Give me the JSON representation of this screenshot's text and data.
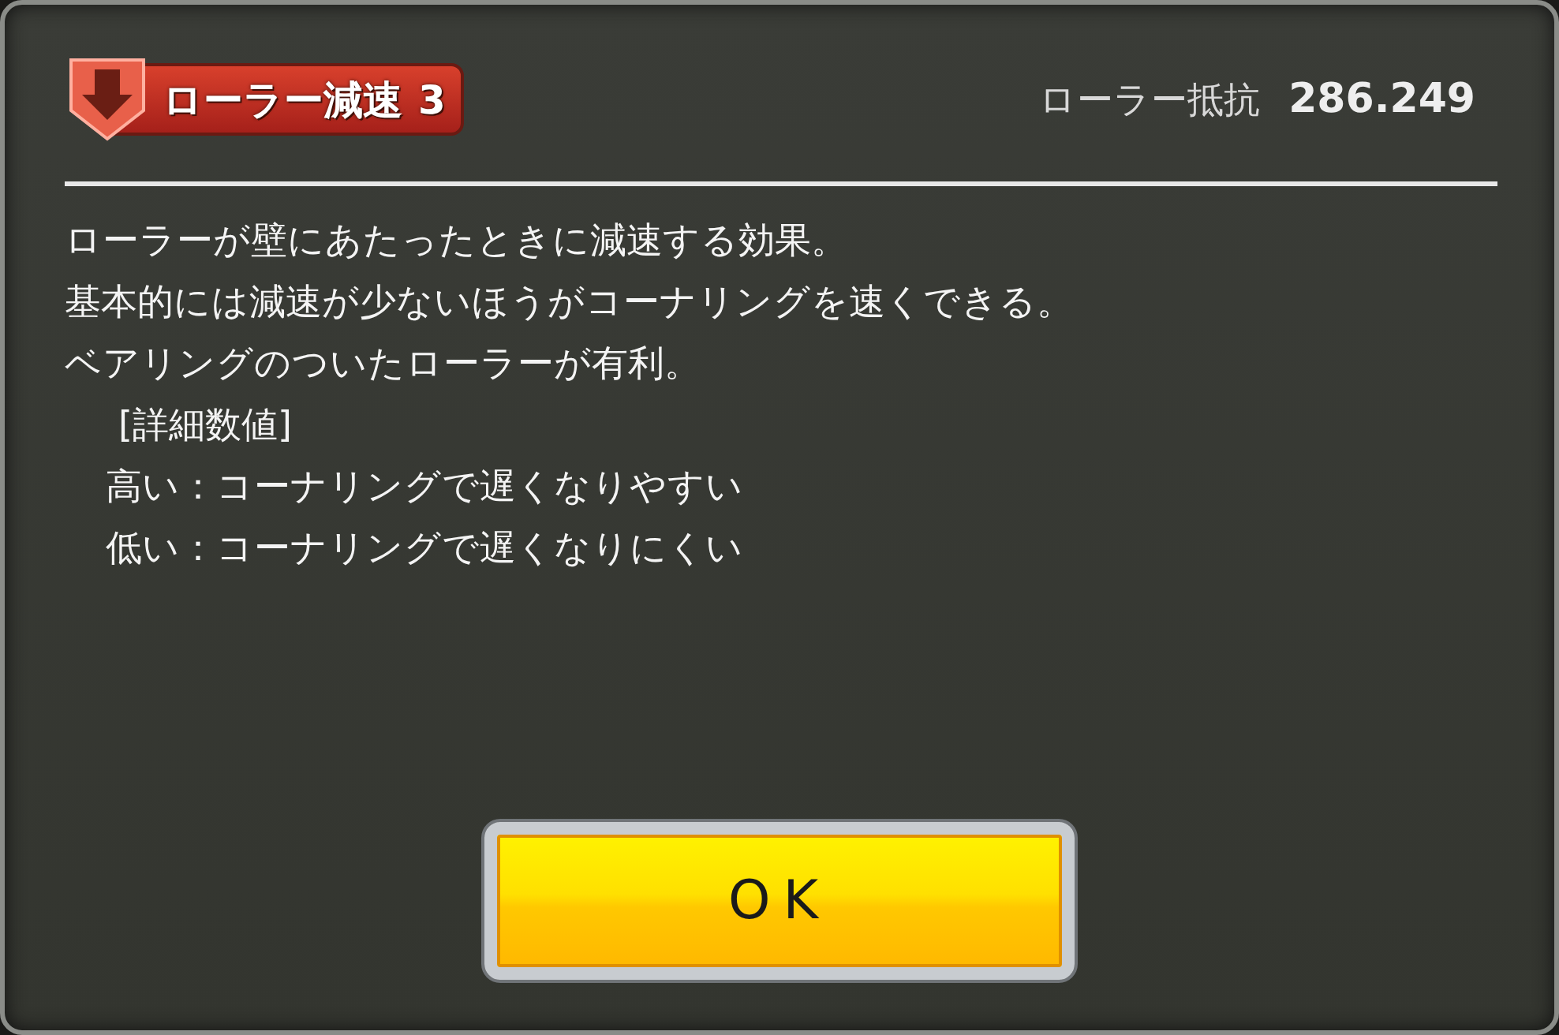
{
  "header": {
    "badge": {
      "kind": "debuff",
      "label": "ローラー減速",
      "level_text": "3"
    },
    "stat_label": "ローラー抵抗",
    "stat_value": "286.249"
  },
  "description": [
    {
      "kind": "body",
      "text": "ローラーが壁にあたったときに減速する効果。"
    },
    {
      "kind": "body",
      "text": "基本的には減速が少ないほうがコーナリングを速くできる。"
    },
    {
      "kind": "body",
      "text": "ベアリングのついたローラーが有利。"
    },
    {
      "kind": "heading",
      "text": "[詳細数値]"
    },
    {
      "kind": "detail",
      "text": "高い：コーナリングで遅くなりやすい"
    },
    {
      "kind": "detail",
      "text": "低い：コーナリングで遅くなりにくい"
    }
  ],
  "buttons": [
    {
      "label": "OK"
    }
  ]
}
